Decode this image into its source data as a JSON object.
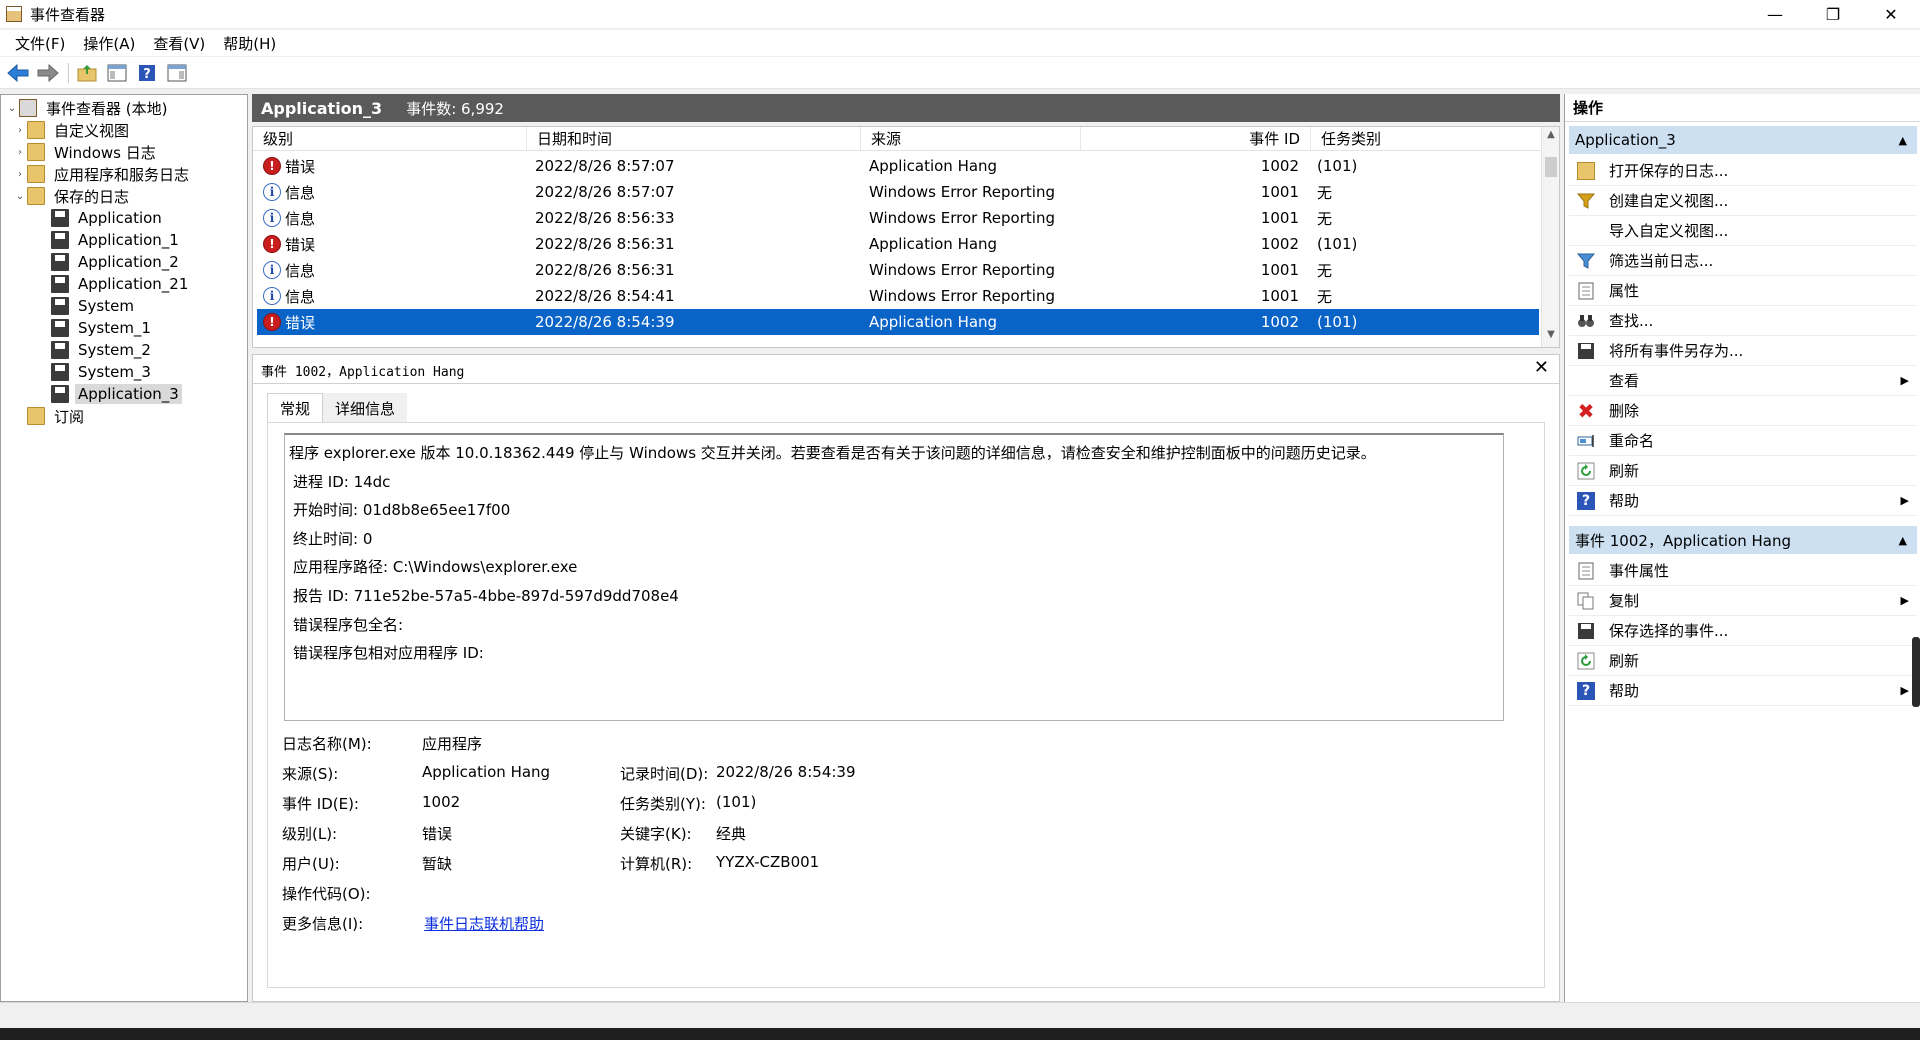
{
  "window": {
    "title": "事件查看器",
    "minimize": "—",
    "maximize": "❐",
    "close": "✕"
  },
  "menu": [
    "文件(F)",
    "操作(A)",
    "查看(V)",
    "帮助(H)"
  ],
  "tree": {
    "root": "事件查看器 (本地)",
    "custom_views": "自定义视图",
    "windows_logs": "Windows 日志",
    "app_service_logs": "应用程序和服务日志",
    "saved_logs": "保存的日志",
    "saved": [
      "Application",
      "Application_1",
      "Application_2",
      "Application_21",
      "System",
      "System_1",
      "System_2",
      "System_3",
      "Application_3"
    ],
    "subscriptions": "订阅"
  },
  "log_header": {
    "name": "Application_3",
    "count": "事件数: 6,992"
  },
  "columns": {
    "level": "级别",
    "datetime": "日期和时间",
    "source": "来源",
    "event_id": "事件 ID",
    "task": "任务类别"
  },
  "events": [
    {
      "level": "错误",
      "type": "error",
      "datetime": "2022/8/26 8:57:07",
      "source": "Application Hang",
      "id": "1002",
      "task": "(101)"
    },
    {
      "level": "信息",
      "type": "info",
      "datetime": "2022/8/26 8:57:07",
      "source": "Windows Error Reporting",
      "id": "1001",
      "task": "无"
    },
    {
      "level": "信息",
      "type": "info",
      "datetime": "2022/8/26 8:56:33",
      "source": "Windows Error Reporting",
      "id": "1001",
      "task": "无"
    },
    {
      "level": "错误",
      "type": "error",
      "datetime": "2022/8/26 8:56:31",
      "source": "Application Hang",
      "id": "1002",
      "task": "(101)"
    },
    {
      "level": "信息",
      "type": "info",
      "datetime": "2022/8/26 8:56:31",
      "source": "Windows Error Reporting",
      "id": "1001",
      "task": "无"
    },
    {
      "level": "信息",
      "type": "info",
      "datetime": "2022/8/26 8:54:41",
      "source": "Windows Error Reporting",
      "id": "1001",
      "task": "无"
    },
    {
      "level": "错误",
      "type": "error",
      "datetime": "2022/8/26 8:54:39",
      "source": "Application Hang",
      "id": "1002",
      "task": "(101)"
    }
  ],
  "detail": {
    "title": "事件 1002，Application Hang",
    "close": "✕",
    "tabs": [
      "常规",
      "详细信息"
    ],
    "description": [
      "程序 explorer.exe 版本 10.0.18362.449 停止与 Windows 交互并关闭。若要查看是否有关于该问题的详细信息，请检查安全和维护控制面板中的问题历史记录。",
      "进程 ID: 14dc",
      "开始时间: 01d8b8e65ee17f00",
      "终止时间: 0",
      "应用程序路径: C:\\Windows\\explorer.exe",
      "报告 ID: 711e52be-57a5-4bbe-897d-597d9dd708e4",
      "错误程序包全名:",
      "错误程序包相对应用程序 ID:"
    ],
    "props": {
      "log_name_label": "日志名称(M):",
      "log_name": "应用程序",
      "source_label": "来源(S):",
      "source": "Application Hang",
      "logged_label": "记录时间(D):",
      "logged": "2022/8/26 8:54:39",
      "event_id_label": "事件 ID(E):",
      "event_id": "1002",
      "task_label": "任务类别(Y):",
      "task": "(101)",
      "level_label": "级别(L):",
      "level": "错误",
      "keywords_label": "关键字(K):",
      "keywords": "经典",
      "user_label": "用户(U):",
      "user": "暂缺",
      "computer_label": "计算机(R):",
      "computer": "YYZX-CZB001",
      "opcode_label": "操作代码(O):",
      "more_info_label": "更多信息(I):",
      "more_info_link": "事件日志联机帮助"
    }
  },
  "actions": {
    "header": "操作",
    "section1": "Application_3",
    "section1_items": [
      "打开保存的日志...",
      "创建自定义视图...",
      "导入自定义视图...",
      "筛选当前日志...",
      "属性",
      "查找...",
      "将所有事件另存为...",
      "查看",
      "删除",
      "重命名",
      "刷新",
      "帮助"
    ],
    "section2": "事件 1002，Application Hang",
    "section2_items": [
      "事件属性",
      "复制",
      "保存选择的事件...",
      "刷新",
      "帮助"
    ]
  },
  "colors": {
    "selection": "#0a64c8",
    "header_dark": "#5a5a5a",
    "section_blue": "#cce0f2",
    "link": "#0b2ee0",
    "error_red": "#c81e1e"
  }
}
